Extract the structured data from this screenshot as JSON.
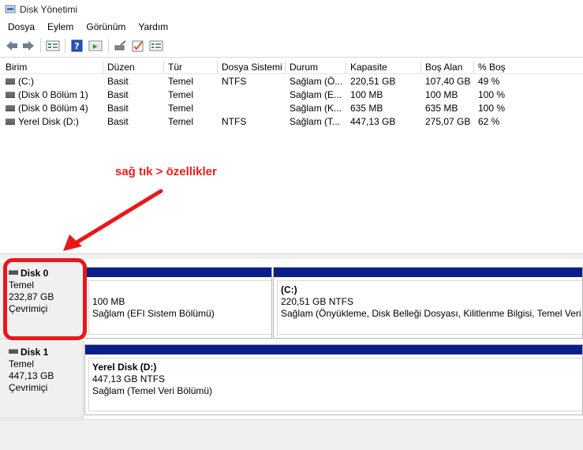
{
  "window": {
    "title": "Disk Yönetimi",
    "app_icon": "disk-management-icon"
  },
  "menu": [
    "Dosya",
    "Eylem",
    "Görünüm",
    "Yardım"
  ],
  "toolbar": {
    "icons": [
      "back-arrow-icon",
      "forward-arrow-icon",
      "list-view-icon",
      "help-icon",
      "properties-icon",
      "connect-icon",
      "check-icon",
      "settings-icon"
    ]
  },
  "volume_list": {
    "columns": [
      "Birim",
      "Düzen",
      "Tür",
      "Dosya Sistemi",
      "Durum",
      "Kapasite",
      "Boş Alan",
      "% Boş"
    ],
    "rows": [
      [
        "(C:)",
        "Basit",
        "Temel",
        "NTFS",
        "Sağlam (Ö...",
        "220,51 GB",
        "107,40 GB",
        "49 %"
      ],
      [
        "(Disk 0 Bölüm 1)",
        "Basit",
        "Temel",
        "",
        "Sağlam (E...",
        "100 MB",
        "100 MB",
        "100 %"
      ],
      [
        "(Disk 0 Bölüm 4)",
        "Basit",
        "Temel",
        "",
        "Sağlam (K...",
        "635 MB",
        "635 MB",
        "100 %"
      ],
      [
        "Yerel Disk (D:)",
        "Basit",
        "Temel",
        "NTFS",
        "Sağlam (T...",
        "447,13 GB",
        "275,07 GB",
        "62 %"
      ]
    ]
  },
  "disks": [
    {
      "name": "Disk 0",
      "type": "Temel",
      "size": "232,87 GB",
      "status": "Çevrimiçi",
      "partitions": [
        {
          "name": "",
          "size": "100 MB",
          "status": "Sağlam (EFI Sistem Bölümü)"
        },
        {
          "name": "(C:)",
          "size": "220,51 GB NTFS",
          "status": "Sağlam (Önyükleme, Disk Belleği Dosyası, Kilitlenme Bilgisi, Temel Veri Bö"
        }
      ]
    },
    {
      "name": "Disk 1",
      "type": "Temel",
      "size": "447,13 GB",
      "status": "Çevrimiçi",
      "partitions": [
        {
          "name": "Yerel Disk  (D:)",
          "size": "447,13 GB NTFS",
          "status": "Sağlam (Temel Veri Bölümü)"
        }
      ]
    }
  ],
  "annotation": {
    "text": "sağ tık > özellikler",
    "color": "#ee1c1c"
  },
  "colors": {
    "partition_bar": "#0b1f8a",
    "highlight": "#e8181a"
  }
}
